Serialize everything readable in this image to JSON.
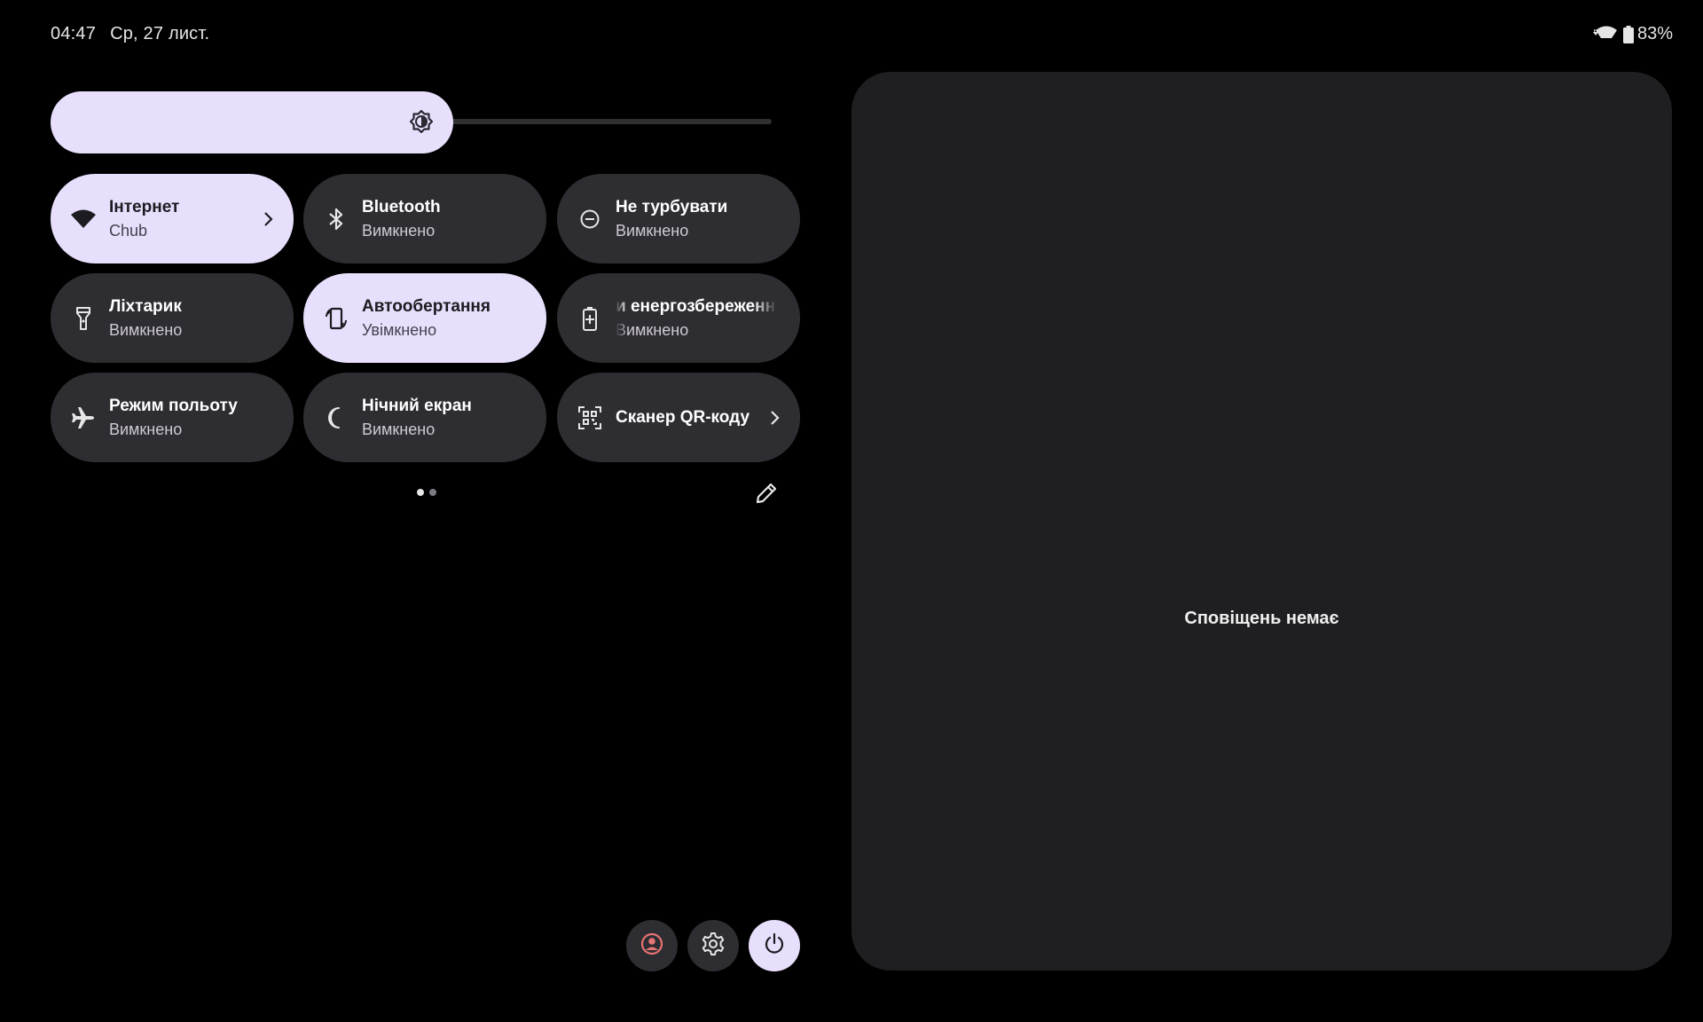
{
  "status_bar": {
    "time": "04:47",
    "date": "Ср, 27 лист.",
    "battery": "83%"
  },
  "brightness": {
    "level_percent": 52,
    "icon": "brightness-icon"
  },
  "tiles": [
    {
      "label": "Інтернет",
      "sub": "Chub",
      "icon": "wifi-icon",
      "active": true,
      "chevron": true
    },
    {
      "label": "Bluetooth",
      "sub": "Вимкнено",
      "icon": "bluetooth-icon",
      "active": false
    },
    {
      "label": "Не турбувати",
      "sub": "Вимкнено",
      "icon": "do-not-disturb-icon",
      "active": false
    },
    {
      "label": "Ліхтарик",
      "sub": "Вимкнено",
      "icon": "flashlight-icon",
      "active": false
    },
    {
      "label": "Автообертання",
      "sub": "Увімкнено",
      "icon": "auto-rotate-icon",
      "active": true
    },
    {
      "label": "и енергозбереження",
      "sub": "Вимкнено",
      "icon": "battery-saver-icon",
      "active": false
    },
    {
      "label": "Режим польоту",
      "sub": "Вимкнено",
      "icon": "airplane-icon",
      "active": false
    },
    {
      "label": "Нічний екран",
      "sub": "Вимкнено",
      "icon": "night-light-icon",
      "active": false
    },
    {
      "label": "Сканер QR-коду",
      "sub": "",
      "icon": "qr-scanner-icon",
      "active": false,
      "chevron": true
    }
  ],
  "pager": {
    "pages": 2,
    "current": 1
  },
  "bottom_buttons": [
    "user-icon",
    "settings-icon",
    "power-icon"
  ],
  "notifications": {
    "empty_text": "Сповіщень немає"
  },
  "colors": {
    "active_tile": "#e8dffc",
    "inactive_tile": "#2e2d31",
    "panel": "#1f1f22",
    "user_accent": "#e57373"
  }
}
